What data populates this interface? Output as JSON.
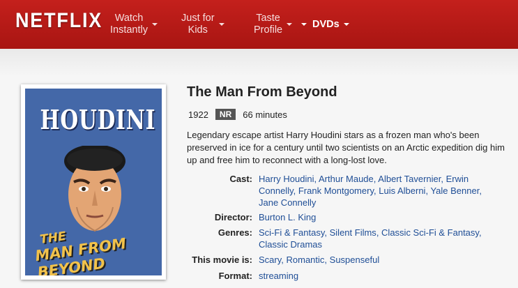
{
  "header": {
    "logo": "NETFLIX",
    "nav": [
      {
        "line1": "Watch",
        "line2": "Instantly"
      },
      {
        "line1": "Just for",
        "line2": "Kids"
      },
      {
        "line1": "Taste",
        "line2": "Profile"
      },
      {
        "line1": "DVDs"
      }
    ]
  },
  "poster": {
    "top_text": "HOUDINI",
    "bottom_line1": "THE",
    "bottom_line2": "MAN FROM BEYOND"
  },
  "movie": {
    "title": "The Man From Beyond",
    "year": "1922",
    "rating": "NR",
    "duration": "66 minutes",
    "synopsis": "Legendary escape artist Harry Houdini stars as a frozen man who's been preserved in ice for a century until two scientists on an Arctic expedition dig him up and free him to reconnect with a long-lost love.",
    "details": [
      {
        "label": "Cast:",
        "values": [
          "Harry Houdini",
          "Arthur Maude",
          "Albert Tavernier",
          "Erwin Connelly",
          "Frank Montgomery",
          "Luis Alberni",
          "Yale Benner",
          "Jane Connelly"
        ]
      },
      {
        "label": "Director:",
        "values": [
          "Burton L. King"
        ]
      },
      {
        "label": "Genres:",
        "values": [
          "Sci-Fi & Fantasy",
          "Silent Films",
          "Classic Sci-Fi & Fantasy",
          "Classic Dramas"
        ]
      },
      {
        "label": "This movie is:",
        "values": [
          "Scary",
          "Romantic",
          "Suspenseful"
        ]
      },
      {
        "label": "Format:",
        "values": [
          "streaming"
        ]
      }
    ]
  },
  "colors": {
    "header_red": "#b81b17",
    "link_blue": "#1f4e96",
    "poster_blue": "#4468a8"
  }
}
